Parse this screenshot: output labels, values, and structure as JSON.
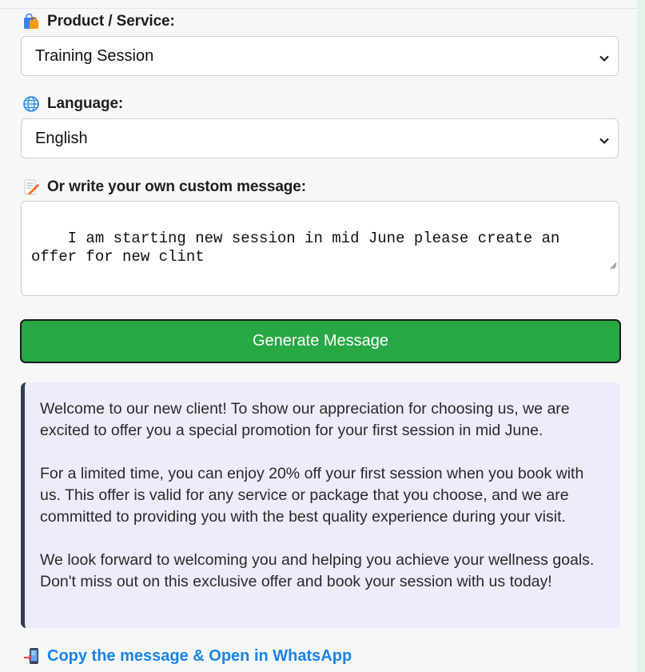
{
  "form": {
    "product_label": "Product / Service:",
    "product_value": "Training Session",
    "language_label": "Language:",
    "language_value": "English",
    "custom_label": "Or write your own custom message:",
    "custom_value": "I am starting new session in mid June please create an offer for new clint",
    "generate_label": "Generate Message"
  },
  "result": {
    "paragraphs": [
      "Welcome to our new client! To show our appreciation for choosing us, we are excited to offer you a special promotion for your first session in mid June.",
      "For a limited time, you can enjoy 20% off your first session when you book with us. This offer is valid for any service or package that you choose, and we are committed to providing you with the best quality experience during your visit.",
      "We look forward to welcoming you and helping you achieve your wellness goals. Don't miss out on this exclusive offer and book your session with us today!"
    ]
  },
  "whatsapp_link": "Copy the message & Open in WhatsApp",
  "icons": {
    "product": "shopping-bag-icon",
    "language": "globe-icon",
    "custom": "memo-pencil-icon",
    "whatsapp": "mobile-phone-arrow-icon"
  },
  "colors": {
    "button": "#28a745",
    "link": "#1b84e4",
    "result_bg": "#ececfb",
    "result_border": "#2f3d57"
  }
}
